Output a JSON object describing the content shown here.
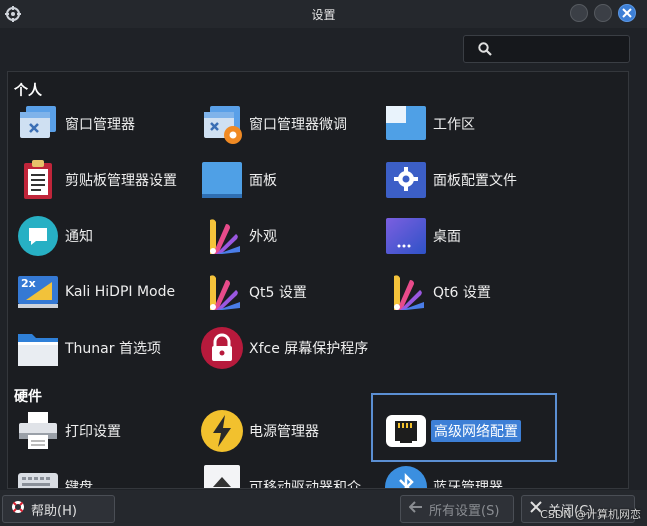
{
  "window": {
    "title": "设置"
  },
  "search": {
    "placeholder": ""
  },
  "sections": {
    "personal": "个人",
    "hardware": "硬件"
  },
  "items": {
    "wm": "窗口管理器",
    "wmtweaks": "窗口管理器微调",
    "workspaces": "工作区",
    "clipboard": "剪贴板管理器设置",
    "panel": "面板",
    "panelprofiles": "面板配置文件",
    "notify": "通知",
    "appearance": "外观",
    "desktop": "桌面",
    "hidpi": "Kali HiDPI Mode",
    "qt5": "Qt5 设置",
    "qt6": "Qt6 设置",
    "thunar": "Thunar 首选项",
    "screensaver": "Xfce 屏幕保护程序",
    "printing": "打印设置",
    "power": "电源管理器",
    "network": "高级网络配置",
    "keyboard": "键盘",
    "removable": "可移动驱动器和介",
    "bluetooth": "蓝牙管理器"
  },
  "buttons": {
    "help": "帮助(H)",
    "all_settings": "所有设置(S)",
    "close": "关闭(C)"
  },
  "watermark": "CSDN @计算机网恋",
  "colors": {
    "accent": "#3d7fd6",
    "background": "#1f2227"
  }
}
